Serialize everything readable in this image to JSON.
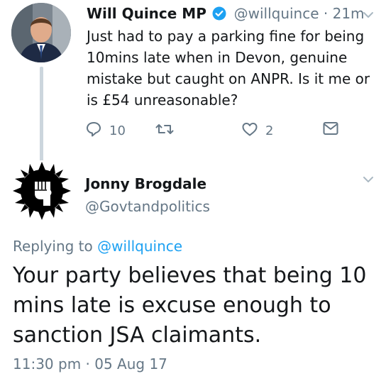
{
  "tweet": {
    "author_name": "Will Quince MP",
    "handle": "@willquince",
    "separator": "·",
    "time": "21m",
    "text": "Just had to pay a parking fine for being 10mins late when in Devon, genuine mistake but caught on ANPR. Is it me or is £54 unreasonable?",
    "reply_count": "10",
    "like_count": "2"
  },
  "reply": {
    "author_name": "Jonny Brogdale",
    "handle": "@Govtandpolitics",
    "replying_prefix": "Replying to",
    "replying_to": "@willquince",
    "text": "Your party believes that being 10 mins late is excuse enough to sanction JSA claimants.",
    "timestamp": "11:30 pm · 05 Aug 17"
  },
  "colors": {
    "verified": "#1da1f2",
    "link": "#1da1f2",
    "secondary_text": "#657786",
    "thread_line": "#ccd6dd"
  },
  "icons": [
    "verified-icon",
    "chevron-down-icon",
    "reply-icon",
    "retweet-icon",
    "like-icon",
    "direct-message-icon"
  ]
}
